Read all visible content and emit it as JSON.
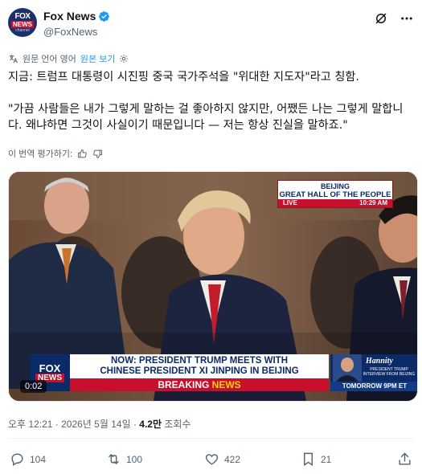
{
  "account": {
    "display_name": "Fox News",
    "handle": "@FoxNews",
    "verified_icon": "verified-badge-icon",
    "avatar_text": {
      "top": "FOX",
      "middle": "NEWS",
      "bottom": "channel"
    }
  },
  "header_icons": [
    "grok-icon",
    "more-icon"
  ],
  "translation": {
    "notice": "원문 언어 영어",
    "show_original": "원본 보기"
  },
  "post": {
    "text": "지금: 트럼프 대통령이 시진핑 중국 국가주석을 \"위대한 지도자\"라고 칭함.\n\n\"가끔 사람들은 내가 그렇게 말하는 걸 좋아하지 않지만, 어쨌든 나는 그렇게 말합니다. 왜냐하면 그것이 사실이기 때문입니다 — 저는 항상 진실을 말하죠.\""
  },
  "rate_translation": "이 번역 평가하기:",
  "video": {
    "time": "0:02",
    "location_line1": "BEIJING",
    "location_line2": "GREAT HALL OF THE PEOPLE",
    "live_label": "LIVE",
    "live_time": "10:29 AM",
    "logo_fox": "FOX",
    "logo_news": "NEWS",
    "headline": "NOW: PRESIDENT TRUMP MEETS WITH\nCHINESE PRESIDENT XI JINPING IN BEIJING",
    "breaking_left": "BREAKING",
    "breaking_right": "NEWS",
    "promo_show": "Hannity",
    "promo_sub": "PRESIDENT TRUMP INTERVIEW FROM BEIJING",
    "promo_when": "TOMORROW 9PM ET"
  },
  "meta": {
    "timestamp": "오후 12:21 · 2026년 5월 14일 · ",
    "views": "4.2만",
    "views_label": " 조회수"
  },
  "actions": {
    "replies": "104",
    "reposts": "100",
    "likes": "422",
    "bookmarks": "21"
  },
  "colors": {
    "accent": "#1d9bf0",
    "muted": "#536471",
    "fox_blue": "#0b2a68",
    "fox_red": "#c8102e"
  }
}
